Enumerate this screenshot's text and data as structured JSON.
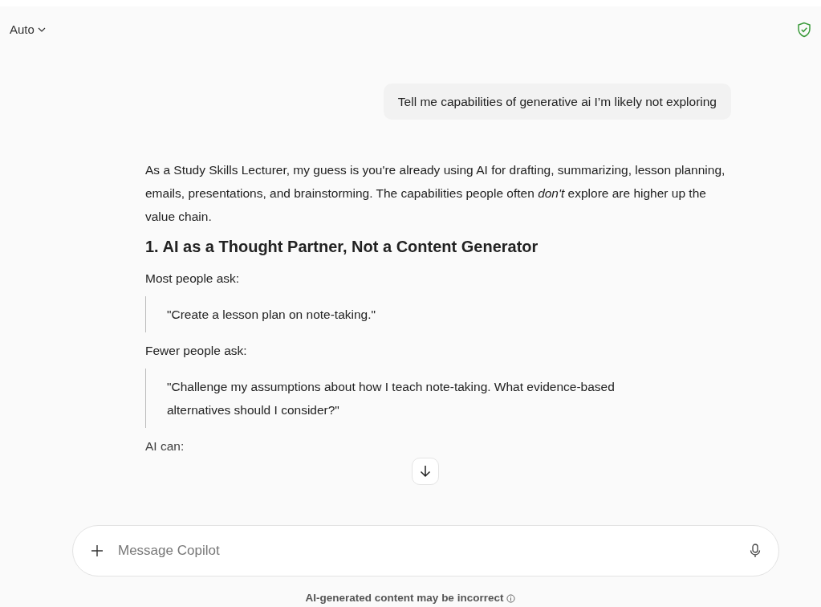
{
  "header": {
    "mode_label": "Auto"
  },
  "user_message": "Tell me capabilities of generative ai I’m likely not exploring",
  "response": [
    {
      "kind": "paragraph",
      "text": "As a Study Skills Lecturer, my guess is you're already using AI for drafting, summarizing, lesson planning, emails, presentations, and brainstorming. The capabilities people often *don't* explore are higher up the value chain."
    },
    {
      "kind": "heading",
      "text": "1. AI as a Thought Partner, Not a Content Generator"
    },
    {
      "kind": "paragraph",
      "text": "Most people ask:"
    },
    {
      "kind": "quote",
      "text": "\"Create a lesson plan on note-taking.\""
    },
    {
      "kind": "paragraph",
      "text": "Fewer people ask:"
    },
    {
      "kind": "quote",
      "text": "\"Challenge my assumptions about how I teach note-taking. What evidence-based alternatives should I consider?\""
    },
    {
      "kind": "paragraph",
      "text": "AI can:"
    }
  ],
  "composer": {
    "placeholder": "Message Copilot"
  },
  "disclaimer": "AI-generated content may be incorrect"
}
